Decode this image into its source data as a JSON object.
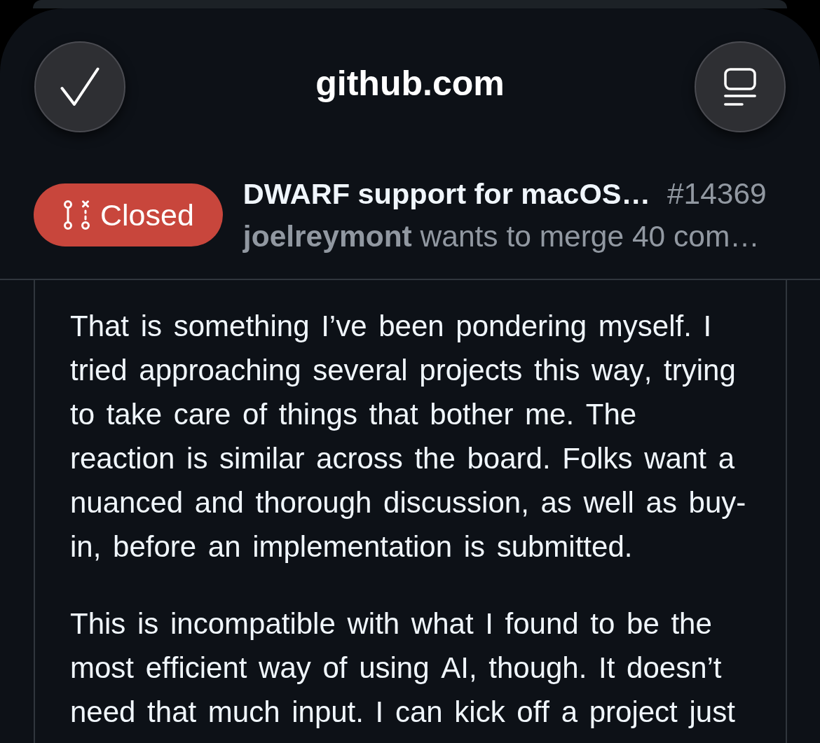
{
  "browser_bar": {
    "title": "github.com"
  },
  "pull_request": {
    "status": {
      "label": "Closed",
      "kind": "closed"
    },
    "title": "DWARF support for macOS…",
    "number": "#14369",
    "summary": "**joelreymont** wants to merge 40 com…"
  },
  "comment": {
    "paragraphs": [
      "That is something I’ve been pondering myself. I tried approaching several projects this way, trying to take care of things that bother me. The reaction is similar across the board. Folks want a nuanced and thorough discussion, as well as buy-in, before an implementation is submitted.",
      "This is incompatible with what I found to be the most efficient way of using AI, though. It doesn’t need that much input. I can kick off a project just"
    ]
  }
}
